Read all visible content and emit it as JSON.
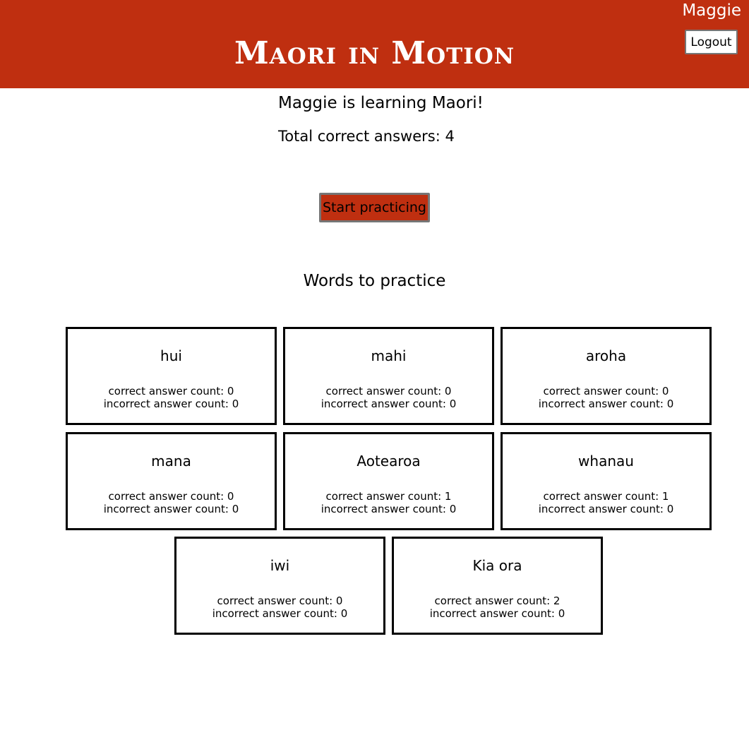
{
  "header": {
    "user_name": "Maggie",
    "logout_label": "Logout",
    "title": "Maori in Motion"
  },
  "colors": {
    "brand": "#bf2f10"
  },
  "main": {
    "learning_text": "Maggie is learning Maori!",
    "total_correct": "Total correct answers: 4",
    "start_label": "Start practicing",
    "words_heading": "Words to practice"
  },
  "words": [
    {
      "word": "hui",
      "correct": "correct answer count: 0",
      "incorrect": "incorrect answer count: 0"
    },
    {
      "word": "mahi",
      "correct": "correct answer count: 0",
      "incorrect": "incorrect answer count: 0"
    },
    {
      "word": "aroha",
      "correct": "correct answer count: 0",
      "incorrect": "incorrect answer count: 0"
    },
    {
      "word": "mana",
      "correct": "correct answer count: 0",
      "incorrect": "incorrect answer count: 0"
    },
    {
      "word": "Aotearoa",
      "correct": "correct answer count: 1",
      "incorrect": "incorrect answer count: 0"
    },
    {
      "word": "whanau",
      "correct": "correct answer count: 1",
      "incorrect": "incorrect answer count: 0"
    },
    {
      "word": "iwi",
      "correct": "correct answer count: 0",
      "incorrect": "incorrect answer count: 0"
    },
    {
      "word": "Kia ora",
      "correct": "correct answer count: 2",
      "incorrect": "incorrect answer count: 0"
    }
  ]
}
